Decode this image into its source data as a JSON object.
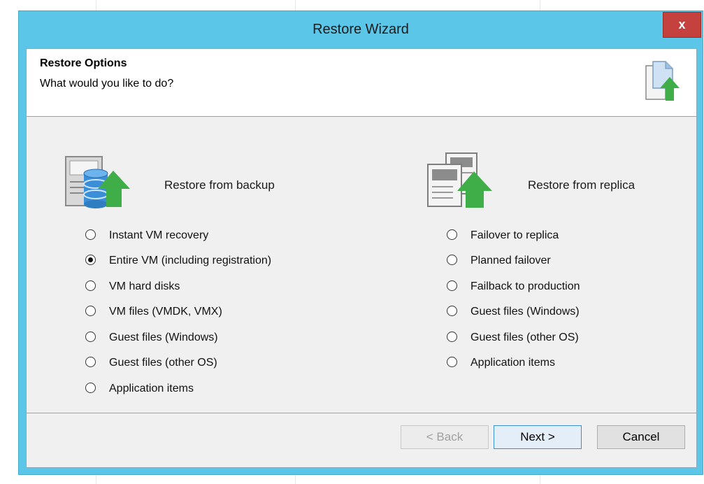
{
  "window": {
    "title": "Restore Wizard",
    "close_label": "x"
  },
  "header": {
    "title": "Restore Options",
    "subtitle": "What would you like to do?"
  },
  "backup": {
    "label": "Restore from backup",
    "options": [
      {
        "label": "Instant VM recovery",
        "selected": false
      },
      {
        "label": "Entire VM (including registration)",
        "selected": true
      },
      {
        "label": "VM hard disks",
        "selected": false
      },
      {
        "label": "VM files (VMDK, VMX)",
        "selected": false
      },
      {
        "label": "Guest files (Windows)",
        "selected": false
      },
      {
        "label": "Guest files (other OS)",
        "selected": false
      },
      {
        "label": "Application items",
        "selected": false
      }
    ]
  },
  "replica": {
    "label": "Restore from replica",
    "options": [
      {
        "label": "Failover to replica",
        "selected": false
      },
      {
        "label": "Planned failover",
        "selected": false
      },
      {
        "label": "Failback to production",
        "selected": false
      },
      {
        "label": "Guest files (Windows)",
        "selected": false
      },
      {
        "label": "Guest files (other OS)",
        "selected": false
      },
      {
        "label": "Application items",
        "selected": false
      }
    ]
  },
  "buttons": {
    "back": "< Back",
    "next": "Next >",
    "cancel": "Cancel"
  },
  "colors": {
    "titlebar": "#5bc6e8",
    "close": "#c4413d",
    "arrow": "#4caf50"
  }
}
